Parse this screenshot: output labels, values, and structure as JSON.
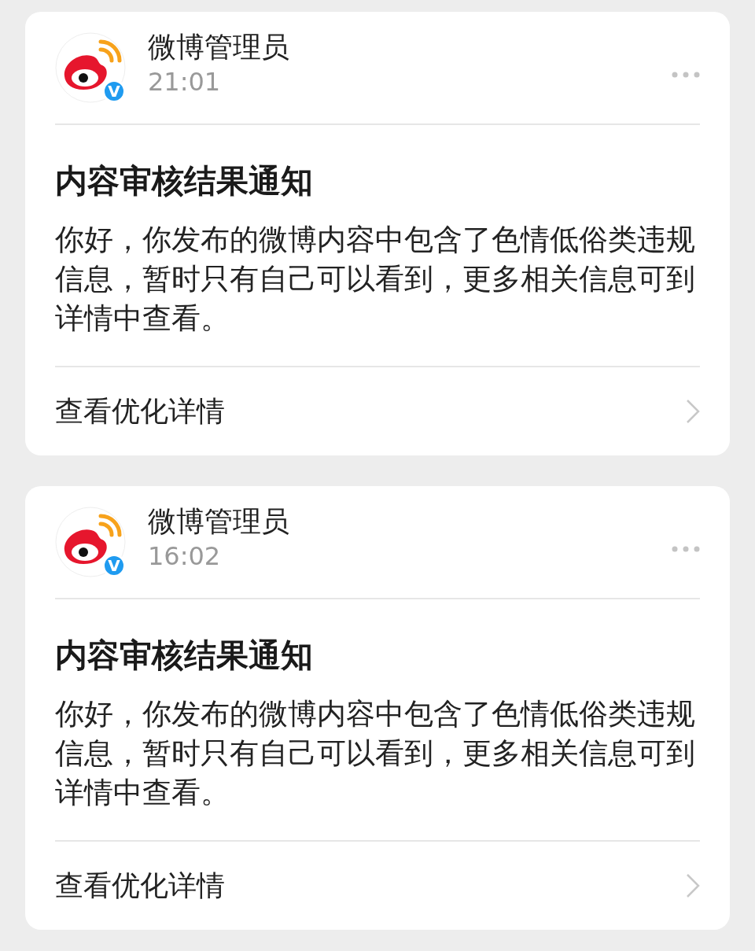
{
  "messages": [
    {
      "sender": "微博管理员",
      "verified_badge": "V",
      "time": "21:01",
      "title": "内容审核结果通知",
      "body": "你好，你发布的微博内容中包含了色情低俗类违规信息，暂时只有自己可以看到，更多相关信息可到详情中查看。",
      "link": "查看优化详情"
    },
    {
      "sender": "微博管理员",
      "verified_badge": "V",
      "time": "16:02",
      "title": "内容审核结果通知",
      "body": "你好，你发布的微博内容中包含了色情低俗类违规信息，暂时只有自己可以看到，更多相关信息可到详情中查看。",
      "link": "查看优化详情"
    }
  ]
}
